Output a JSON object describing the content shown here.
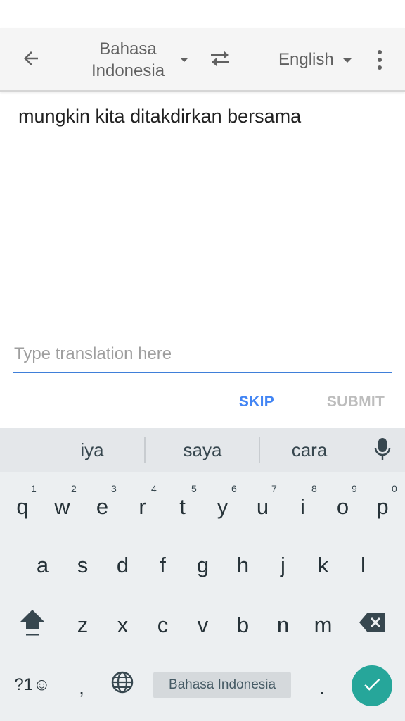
{
  "toolbar": {
    "source_language": "Bahasa Indonesia",
    "target_language": "English"
  },
  "source_text": "mungkin kita ditakdirkan bersama",
  "translation_input": {
    "value": "",
    "placeholder": "Type translation here"
  },
  "actions": {
    "skip_label": "SKIP",
    "submit_label": "SUBMIT"
  },
  "keyboard": {
    "suggestions": [
      "iya",
      "saya",
      "cara"
    ],
    "row1": [
      "q",
      "w",
      "e",
      "r",
      "t",
      "y",
      "u",
      "i",
      "o",
      "p"
    ],
    "row1_hints": [
      "1",
      "2",
      "3",
      "4",
      "5",
      "6",
      "7",
      "8",
      "9",
      "0"
    ],
    "row2": [
      "a",
      "s",
      "d",
      "f",
      "g",
      "h",
      "j",
      "k",
      "l"
    ],
    "row3": [
      "z",
      "x",
      "c",
      "v",
      "b",
      "n",
      "m"
    ],
    "symbols_label": "?1☺",
    "comma_label": ",",
    "period_label": ".",
    "space_label": "Bahasa Indonesia"
  },
  "colors": {
    "accent": "#4285f4",
    "input_underline": "#3f7fd9",
    "enter_key": "#26a69a",
    "keyboard_bg": "#eceff1"
  },
  "icons": [
    "arrow-back-icon",
    "swap-icon",
    "more-vert-icon",
    "mic-icon",
    "shift-icon",
    "backspace-icon",
    "globe-icon",
    "check-icon"
  ]
}
